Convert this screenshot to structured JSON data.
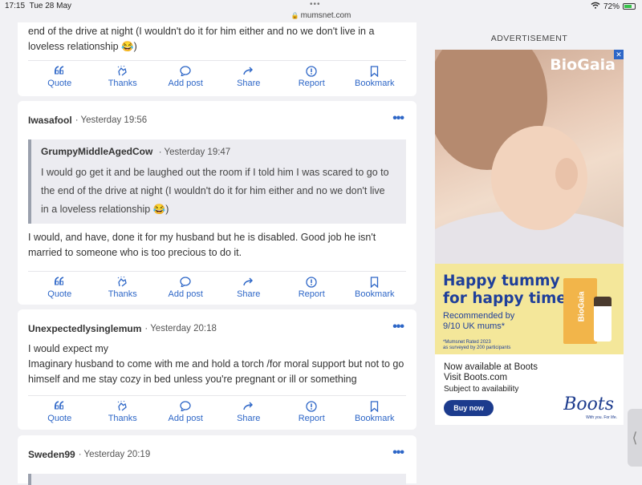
{
  "status": {
    "time": "17:15",
    "date": "Tue 28 May",
    "battery": "72%",
    "battery_level": 0.72
  },
  "browser": {
    "url": "mumsnet.com"
  },
  "actions": [
    "Quote",
    "Thanks",
    "Add post",
    "Share",
    "Report",
    "Bookmark"
  ],
  "posts": [
    {
      "text": "end of the drive at night (I wouldn't do it for him either and no we don't live in a loveless relationship 😂)"
    },
    {
      "author": "Iwasafool",
      "time": "· Yesterday 19:56",
      "quote_author": "GrumpyMiddleAgedCow",
      "quote_time": "· Yesterday 19:47",
      "quote_text": "I would go get it and be laughed out the room if I told him I was scared to go to the end of the drive at night (I wouldn't do it for him either and no we don't live in a loveless relationship 😂)",
      "text": "I would, and have, done it for my husband but he is disabled. Good job he isn't married to someone who is too precious to do it."
    },
    {
      "author": "Unexpectedlysinglemum",
      "time": "· Yesterday 20:18",
      "text_line1": "I would expect my",
      "text_line2": "Imaginary husband to come with me and hold a torch /for moral support but not to go himself and me stay cozy in bed unless you're pregnant or ill or something"
    },
    {
      "author": "Sweden99",
      "time": "· Yesterday 20:19"
    }
  ],
  "sidebar": {
    "ad_label": "ADVERTISEMENT",
    "ad": {
      "brand": "BioGaia",
      "headline_1": "Happy tummy",
      "headline_2": "for happy times!",
      "rec_1": "Recommended by",
      "rec_2": "9/10 UK mums*",
      "fine_1": "*Mumsnet Rated 2023",
      "fine_2": "as surveyed by 200 participants",
      "box_label": "BioGaia",
      "avail_1": "Now available at Boots",
      "avail_2": "Visit Boots.com",
      "avail_3": "Subject to availability",
      "buy": "Buy now",
      "retailer": "Boots",
      "retailer_tag": "With you. For life."
    }
  }
}
